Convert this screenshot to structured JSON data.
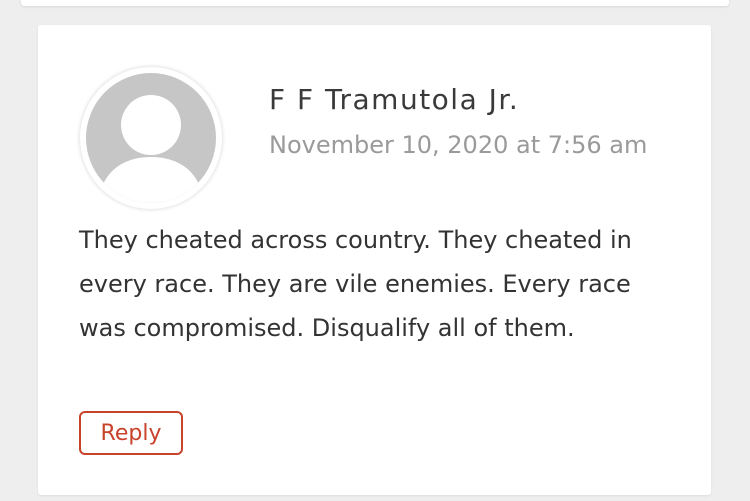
{
  "comment": {
    "author": "F F Tramutola Jr.",
    "date": "November 10, 2020 at 7:56 am",
    "text": "They cheated across country. They cheated in every race. They are vile enemies. Every race was compromised. Disqualify all of them.",
    "reply_label": "Reply",
    "avatar_icon": "default-user-avatar-icon"
  },
  "colors": {
    "page_background": "#eeeeee",
    "card_background": "#ffffff",
    "avatar_gray": "#c6c6c6",
    "accent": "#c8432b",
    "author_text": "#3a3a3a",
    "date_text": "#9a9a9a"
  }
}
